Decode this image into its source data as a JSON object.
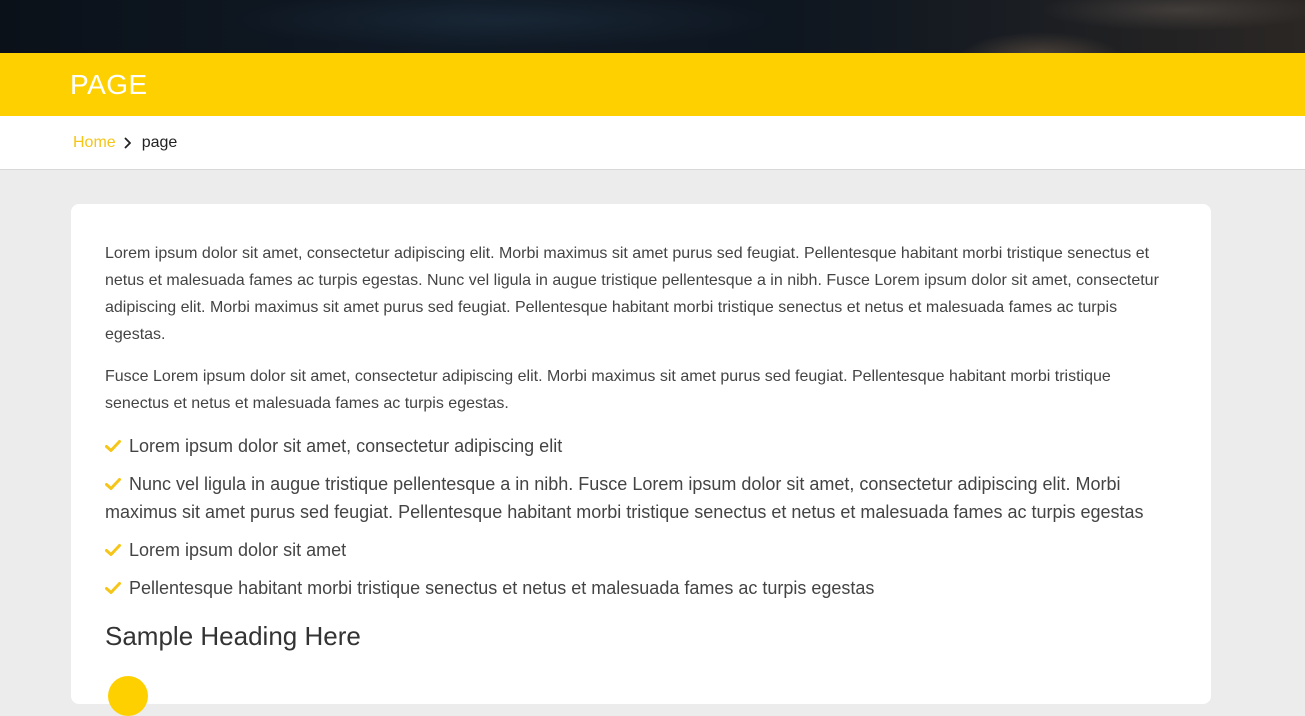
{
  "header": {
    "title": "PAGE"
  },
  "breadcrumb": {
    "home": "Home",
    "current": "page"
  },
  "content": {
    "paragraphs": [
      "Lorem ipsum dolor sit amet, consectetur adipiscing elit. Morbi maximus sit amet purus sed feugiat. Pellentesque habitant morbi tristique senectus et netus et malesuada fames ac turpis egestas. Nunc vel ligula in augue tristique pellentesque a in nibh. Fusce Lorem ipsum dolor sit amet, consectetur adipiscing elit. Morbi maximus sit amet purus sed feugiat. Pellentesque habitant morbi tristique senectus et netus et malesuada fames ac turpis egestas.",
      "Fusce Lorem ipsum dolor sit amet, consectetur adipiscing elit. Morbi maximus sit amet purus sed feugiat. Pellentesque habitant morbi tristique senectus et netus et malesuada fames ac turpis egestas."
    ],
    "checklist": [
      "Lorem ipsum dolor sit amet, consectetur adipiscing elit",
      "Nunc vel ligula in augue tristique pellentesque a in nibh. Fusce Lorem ipsum dolor sit amet, consectetur adipiscing elit. Morbi maximus sit amet purus sed feugiat. Pellentesque habitant morbi tristique senectus et netus et malesuada fames ac turpis egestas",
      "Lorem ipsum dolor sit amet",
      "Pellentesque habitant morbi tristique senectus et netus et malesuada fames ac turpis egestas"
    ],
    "heading": "Sample Heading Here"
  },
  "icons": {
    "breadcrumb_separator": "chevron-right-icon",
    "list_bullet": "check-icon"
  },
  "colors": {
    "accent": "#ffd000",
    "link": "#f5c518",
    "background": "#ececec",
    "card": "#ffffff",
    "text": "#444444"
  }
}
